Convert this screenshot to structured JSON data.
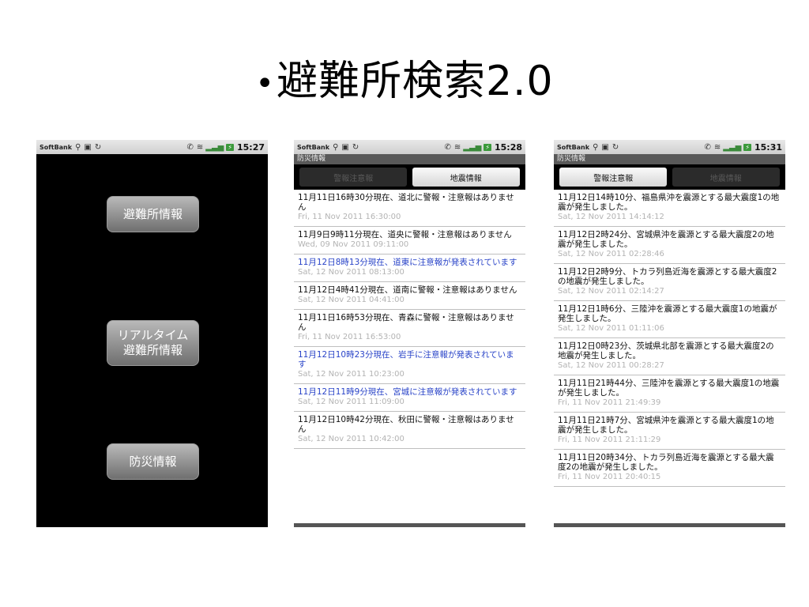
{
  "slide": {
    "bullet": "•",
    "title": "避難所検索2.0"
  },
  "phones": [
    {
      "status": {
        "carrier": "SoftBank",
        "time": "15:27"
      },
      "buttons": [
        "避難所情報",
        "リアルタイム\n避難所情報",
        "防災情報"
      ]
    },
    {
      "status": {
        "carrier": "SoftBank",
        "time": "15:28"
      },
      "titlebar": "防災情報",
      "tabs": [
        {
          "label": "警報注意報",
          "active": false
        },
        {
          "label": "地震情報",
          "active": true
        }
      ],
      "items": [
        {
          "head": "11月11日16時30分現在、道北に警報・注意報はありません",
          "date": "Fri, 11 Nov 2011 16:30:00",
          "blue": false
        },
        {
          "head": "11月9日9時11分現在、道央に警報・注意報はありません",
          "date": "Wed, 09 Nov 2011 09:11:00",
          "blue": false
        },
        {
          "head": "11月12日8時13分現在、道東に注意報が発表されています",
          "date": "Sat, 12 Nov 2011 08:13:00",
          "blue": true
        },
        {
          "head": "11月12日4時41分現在、道南に警報・注意報はありません",
          "date": "Sat, 12 Nov 2011 04:41:00",
          "blue": false
        },
        {
          "head": "11月11日16時53分現在、青森に警報・注意報はありません",
          "date": "Fri, 11 Nov 2011 16:53:00",
          "blue": false
        },
        {
          "head": "11月12日10時23分現在、岩手に注意報が発表されています",
          "date": "Sat, 12 Nov 2011 10:23:00",
          "blue": true
        },
        {
          "head": "11月12日11時9分現在、宮城に注意報が発表されています",
          "date": "Sat, 12 Nov 2011 11:09:00",
          "blue": true
        },
        {
          "head": "11月12日10時42分現在、秋田に警報・注意報はありません",
          "date": "Sat, 12 Nov 2011 10:42:00",
          "blue": false
        }
      ]
    },
    {
      "status": {
        "carrier": "SoftBank",
        "time": "15:31"
      },
      "titlebar": "防災情報",
      "tabs": [
        {
          "label": "警報注意報",
          "active": true
        },
        {
          "label": "地震情報",
          "active": false
        }
      ],
      "items": [
        {
          "head": "11月12日14時10分、福島県沖を震源とする最大震度1の地震が発生しました。",
          "date": "Sat, 12 Nov 2011 14:14:12"
        },
        {
          "head": "11月12日2時24分、宮城県沖を震源とする最大震度2の地震が発生しました。",
          "date": "Sat, 12 Nov 2011 02:28:46"
        },
        {
          "head": "11月12日2時9分、トカラ列島近海を震源とする最大震度2の地震が発生しました。",
          "date": "Sat, 12 Nov 2011 02:14:27"
        },
        {
          "head": "11月12日1時6分、三陸沖を震源とする最大震度1の地震が発生しました。",
          "date": "Sat, 12 Nov 2011 01:11:06"
        },
        {
          "head": "11月12日0時23分、茨城県北部を震源とする最大震度2の地震が発生しました。",
          "date": "Sat, 12 Nov 2011 00:28:27"
        },
        {
          "head": "11月11日21時44分、三陸沖を震源とする最大震度1の地震が発生しました。",
          "date": "Fri, 11 Nov 2011 21:49:39"
        },
        {
          "head": "11月11日21時7分、宮城県沖を震源とする最大震度1の地震が発生しました。",
          "date": "Fri, 11 Nov 2011 21:11:29"
        },
        {
          "head": "11月11日20時34分、トカラ列島近海を震源とする最大震度2の地震が発生しました。",
          "date": "Fri, 11 Nov 2011 20:40:15"
        }
      ]
    }
  ]
}
